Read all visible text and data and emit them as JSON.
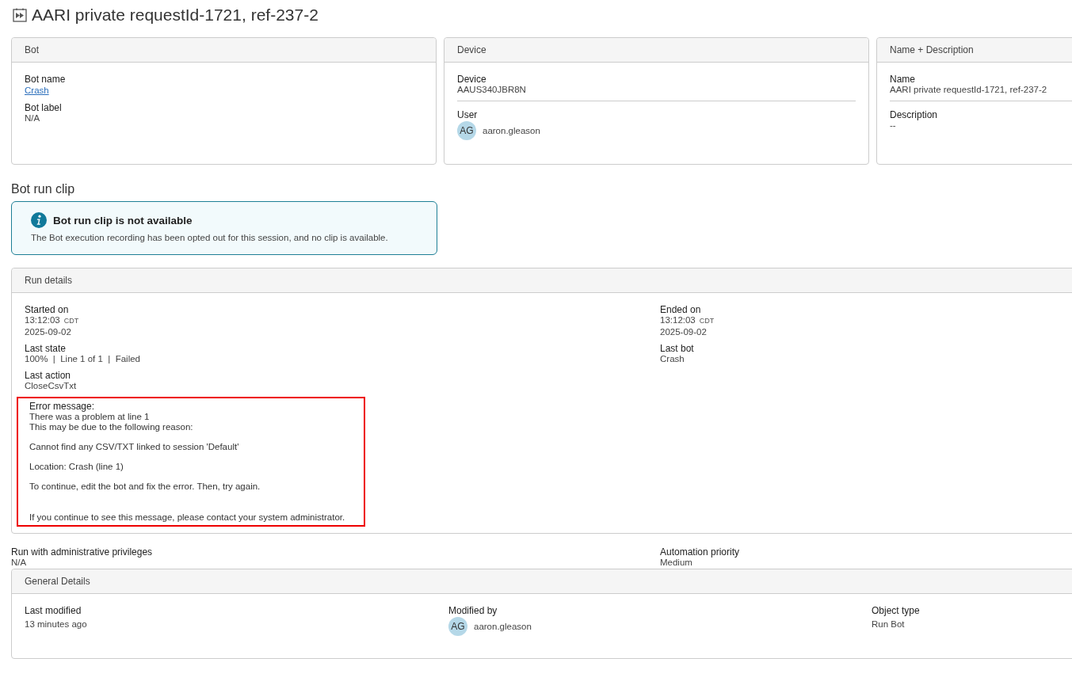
{
  "title": "AARI private requestId-1721, ref-237-2",
  "cards": [
    {
      "heading": "Bot",
      "divided": false,
      "fields": [
        {
          "kind": "link",
          "label": "Bot name",
          "value": "Crash"
        },
        {
          "kind": "text",
          "label": "Bot label",
          "value": "N/A"
        }
      ]
    },
    {
      "heading": "Device",
      "divided": true,
      "fields": [
        {
          "kind": "text",
          "label": "Device",
          "value": "AAUS340JBR8N"
        },
        {
          "kind": "user",
          "label": "User",
          "avatar": "AG",
          "value": "aaron.gleason"
        }
      ]
    },
    {
      "heading": "Name + Description",
      "divided": true,
      "fields": [
        {
          "kind": "text",
          "label": "Name",
          "value": "AARI private requestId-1721, ref-237-2"
        },
        {
          "kind": "text",
          "label": "Description",
          "value": "--"
        }
      ]
    }
  ],
  "clip": {
    "heading": "Bot run clip",
    "notice_title": "Bot run clip is not available",
    "notice_text": "The Bot execution recording has been opted out for this session, and no clip is available."
  },
  "run_details": {
    "heading": "Run details",
    "left": [
      {
        "kind": "datetime",
        "label": "Started on",
        "time": "13:12:03",
        "zone": "CDT",
        "date": "2025-09-02"
      },
      {
        "kind": "text",
        "label": "Last state",
        "value": "100%  |  Line 1 of 1  |  Failed"
      },
      {
        "kind": "text",
        "label": "Last action",
        "value": "CloseCsvTxt"
      }
    ],
    "right": [
      {
        "kind": "datetime",
        "label": "Ended on",
        "time": "13:12:03",
        "zone": "CDT",
        "date": "2025-09-02"
      },
      {
        "kind": "text",
        "label": "Last bot",
        "value": "Crash"
      }
    ],
    "error": {
      "label": "Error message:",
      "paragraphs": [
        [
          "There was a problem at line 1",
          "This may be due to the following reason:"
        ],
        [
          "Cannot find any CSV/TXT linked to session 'Default'"
        ],
        [
          "Location: Crash (line 1)"
        ],
        [
          "To continue, edit the bot and fix the error. Then, try again."
        ],
        [
          "If you continue to see this message, please contact your system administrator."
        ]
      ]
    }
  },
  "extra": [
    {
      "kind": "text",
      "label": "Run with administrative privileges",
      "value": "N/A"
    },
    {
      "kind": "text",
      "label": "Automation priority",
      "value": "Medium"
    }
  ],
  "general": {
    "heading": "General Details",
    "fields": [
      {
        "kind": "text",
        "label": "Last modified",
        "value": "13 minutes ago"
      },
      {
        "kind": "user",
        "label": "Modified by",
        "avatar": "AG",
        "value": "aaron.gleason"
      },
      {
        "kind": "text",
        "label": "Object type",
        "value": "Run Bot"
      }
    ]
  }
}
